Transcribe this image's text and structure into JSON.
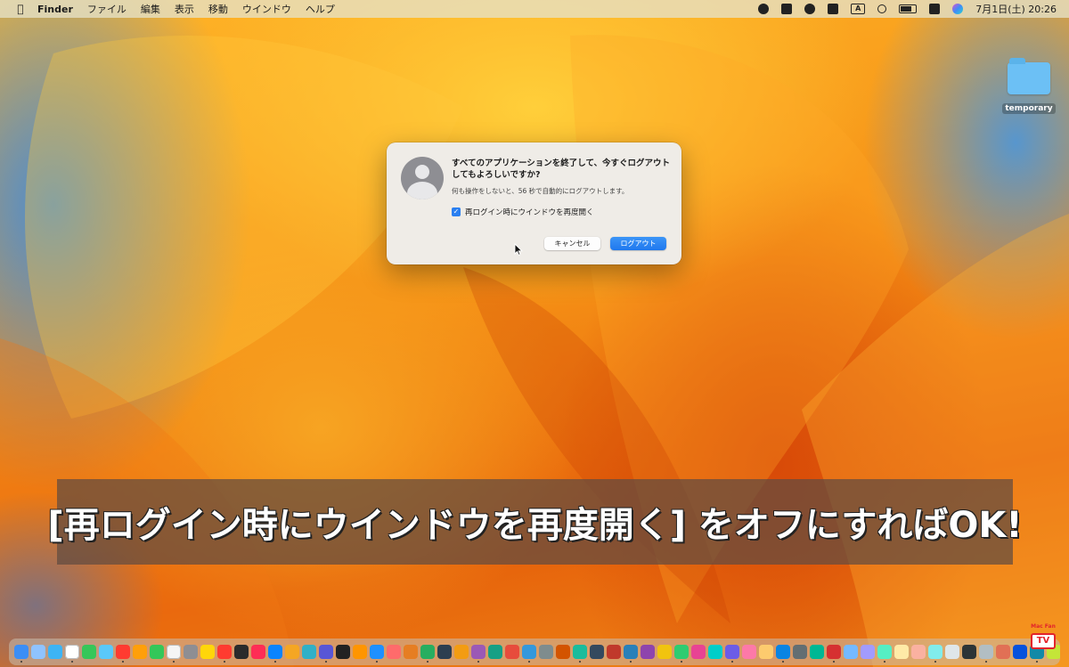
{
  "menubar": {
    "apple_icon": "apple-icon",
    "app_name": "Finder",
    "items": [
      "ファイル",
      "編集",
      "表示",
      "移動",
      "ウインドウ",
      "ヘルプ"
    ],
    "status_icons": [
      "privacy-dot-icon",
      "dropbox-icon",
      "app-shield-icon",
      "app-box-icon",
      "input-method-icon",
      "search-icon",
      "battery-icon",
      "control-center-icon",
      "siri-icon"
    ],
    "input_method_label": "A",
    "clock": "7月1日(土) 20:26"
  },
  "desktop": {
    "folder": {
      "label": "temporary",
      "color": "#6cc0f5"
    }
  },
  "dialog": {
    "title": "すべてのアプリケーションを終了して、今すぐログアウトしてもよろしいですか?",
    "message": "何も操作をしないと、56 秒で自動的にログアウトします。",
    "checkbox_label": "再ログイン時にウインドウを再度開く",
    "checkbox_checked": true,
    "cancel_label": "キャンセル",
    "logout_label": "ログアウト",
    "accent_color": "#2a7ff0"
  },
  "caption": {
    "text": "[再ログイン時にウインドウを再度開く] をオフにすればOK!"
  },
  "dock": {
    "icon_colors": [
      "#3c8ef5",
      "#8fc3ff",
      "#3db4f5",
      "#ffffff",
      "#36c759",
      "#5ac8fa",
      "#ff3b30",
      "#ff9f0a",
      "#34c759",
      "#f5f5f5",
      "#8e8e93",
      "#ffd60a",
      "#ff3b30",
      "#2b2b2b",
      "#ff2d55",
      "#0a84ff",
      "#f5a623",
      "#30b0c7",
      "#5856d6",
      "#222222",
      "#ff9500",
      "#1e90ff",
      "#ff6b6b",
      "#e67e22",
      "#27ae60",
      "#2c3e50",
      "#f39c12",
      "#9b59b6",
      "#16a085",
      "#e74c3c",
      "#3498db",
      "#7f8c8d",
      "#d35400",
      "#1abc9c",
      "#34495e",
      "#c0392b",
      "#2980b9",
      "#8e44ad",
      "#f1c40f",
      "#2ecc71",
      "#e84393",
      "#00cec9",
      "#6c5ce7",
      "#fd79a8",
      "#fdcb6e",
      "#0984e3",
      "#636e72",
      "#00b894",
      "#d63031",
      "#74b9ff",
      "#a29bfe",
      "#55efc4",
      "#ffeaa7",
      "#fab1a0",
      "#81ecec",
      "#dfe6e9",
      "#2d3436",
      "#b2bec3",
      "#e17055",
      "#0652dd",
      "#1289a7",
      "#c4e538",
      "#ffc312",
      "#ed4c67",
      "#9980fa",
      "#5758bb",
      "#12cbc4",
      "#fda7df",
      "#a3cb38",
      "#1b1464",
      "#ea2027",
      "#006266",
      "#1e3799",
      "#4a69bd",
      "#60a3bc",
      "#78e08f"
    ]
  },
  "watermark": {
    "top_text": "Mac Fan",
    "tv_text": "TV"
  }
}
